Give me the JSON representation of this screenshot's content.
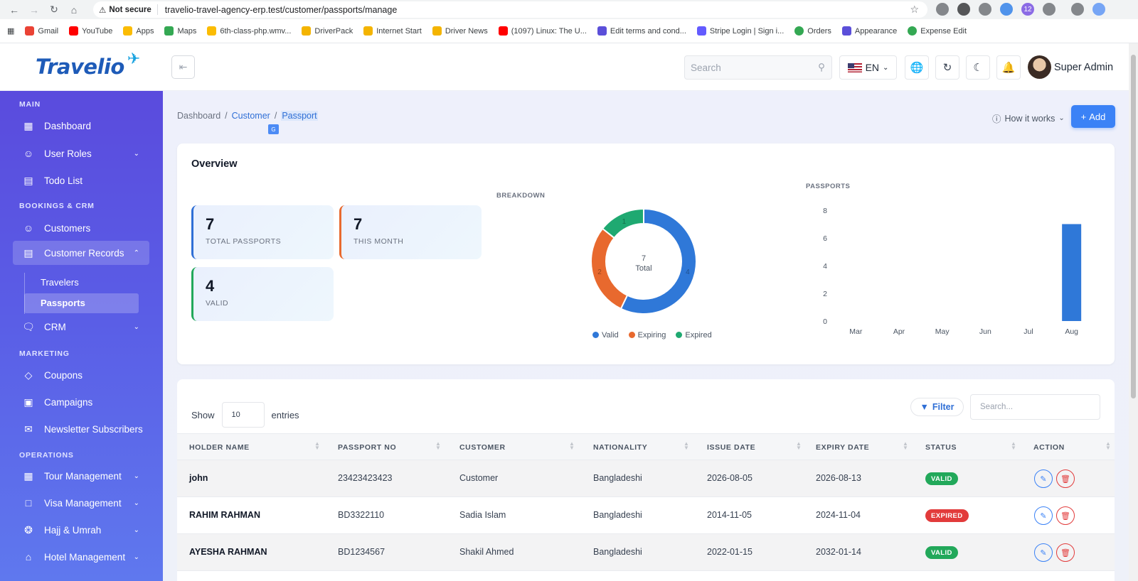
{
  "browser": {
    "security_label": "Not secure",
    "url": "travelio-travel-agency-erp.test/customer/passports/manage",
    "bookmarks": [
      "Gmail",
      "YouTube",
      "Apps",
      "Maps",
      "6th-class-php.wmv...",
      "DriverPack",
      "Internet Start",
      "Driver News",
      "(1097) Linux: The U...",
      "Edit terms and cond...",
      "Stripe Login | Sign i...",
      "Orders",
      "Appearance",
      "Expense Edit"
    ],
    "ext_badge": "12"
  },
  "header": {
    "logo_text": "Travelio",
    "search_placeholder": "Search",
    "language": "EN",
    "user_name": "Super Admin"
  },
  "sidebar": {
    "sections": {
      "main": "MAIN",
      "bookings": "BOOKINGS & CRM",
      "marketing": "MARKETING",
      "operations": "OPERATIONS"
    },
    "items": {
      "dashboard": "Dashboard",
      "user_roles": "User Roles",
      "todo": "Todo List",
      "customers": "Customers",
      "customer_records": "Customer Records",
      "travelers": "Travelers",
      "passports": "Passports",
      "crm": "CRM",
      "coupons": "Coupons",
      "campaigns": "Campaigns",
      "newsletter": "Newsletter Subscribers",
      "tour": "Tour Management",
      "visa": "Visa Management",
      "hajj": "Hajj & Umrah",
      "hotel": "Hotel Management"
    }
  },
  "page": {
    "breadcrumb": [
      "Dashboard",
      "Customer",
      "Passport"
    ],
    "how_it_works": "How it works",
    "add_label": "Add"
  },
  "overview": {
    "title": "Overview",
    "stats": [
      {
        "value": "7",
        "label": "TOTAL PASSPORTS",
        "accent": "#2f6fd6"
      },
      {
        "value": "7",
        "label": "THIS MONTH",
        "accent": "#e8692e"
      },
      {
        "value": "4",
        "label": "VALID",
        "accent": "#22a85a"
      }
    ],
    "breakdown_label": "BREAKDOWN",
    "passports_label": "PASSPORTS"
  },
  "chart_data": [
    {
      "type": "pie",
      "title": "BREAKDOWN",
      "categories": [
        "Valid",
        "Expiring",
        "Expired"
      ],
      "values": [
        4,
        2,
        1
      ],
      "colors": [
        "#2f78d8",
        "#e8692e",
        "#1fa971"
      ],
      "center_value": "7",
      "center_label": "Total",
      "legend": "bottom"
    },
    {
      "type": "bar",
      "title": "PASSPORTS",
      "categories": [
        "Mar",
        "Apr",
        "May",
        "Jun",
        "Jul",
        "Aug"
      ],
      "values": [
        0,
        0,
        0,
        0,
        0,
        7
      ],
      "ylim": [
        0,
        8
      ],
      "yticks": [
        "0",
        "2",
        "4",
        "6",
        "8"
      ],
      "color": "#2f78d8",
      "grid": false
    }
  ],
  "table": {
    "show_label": "Show",
    "entries_value": "10",
    "entries_label": "entries",
    "filter_label": "Filter",
    "search_placeholder": "Search...",
    "columns": [
      "HOLDER NAME",
      "PASSPORT NO",
      "CUSTOMER",
      "NATIONALITY",
      "ISSUE DATE",
      "EXPIRY DATE",
      "STATUS",
      "ACTION"
    ],
    "rows": [
      {
        "holder": "john",
        "passport": "23423423423",
        "customer": "Customer",
        "nationality": "Bangladeshi",
        "issue": "2026-08-05",
        "expiry": "2026-08-13",
        "status": "VALID"
      },
      {
        "holder": "RAHIM RAHMAN",
        "passport": "BD3322110",
        "customer": "Sadia Islam",
        "nationality": "Bangladeshi",
        "issue": "2014-11-05",
        "expiry": "2024-11-04",
        "status": "EXPIRED"
      },
      {
        "holder": "AYESHA RAHMAN",
        "passport": "BD1234567",
        "customer": "Shakil Ahmed",
        "nationality": "Bangladeshi",
        "issue": "2022-01-15",
        "expiry": "2032-01-14",
        "status": "VALID"
      }
    ]
  }
}
